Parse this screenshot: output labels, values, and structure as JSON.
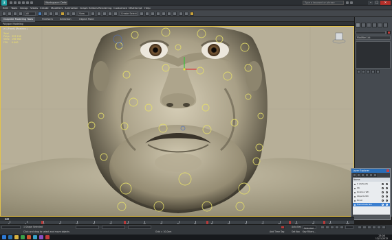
{
  "titlebar": {
    "workspace": "Workspace: Default",
    "search_placeholder": "Type a keyword or phrase"
  },
  "menus": [
    "Edit",
    "Tools",
    "Group",
    "Views",
    "Create",
    "Modifiers",
    "Animation",
    "Graph Editors",
    "Rendering",
    "Customize",
    "MAXScript",
    "Help"
  ],
  "toolbar": {
    "selection_filter": "All",
    "reference_coord": "View",
    "named_selection": "Create Selection Se"
  },
  "ribbon": {
    "tabs": [
      "Graphite Modeling Tools",
      "Freeform",
      "Selection",
      "Object Paint"
    ],
    "active_tab": "Graphite Modeling Tools",
    "sub_label": "Polygon Modeling"
  },
  "viewport": {
    "label": "[+] [Front] [Realistic]",
    "stats": [
      {
        "key": "Polys:",
        "value": "393 236"
      },
      {
        "key": "Verts:",
        "value": "196 968"
      },
      {
        "key": "FPS:",
        "value": "0.000"
      }
    ],
    "stats_header": "Total"
  },
  "command_panel": {
    "modifier_list": "Modifier List"
  },
  "layer_explorer": {
    "title": "Layer Explorer",
    "column": "Name",
    "rows": [
      {
        "label": "0 (default)",
        "selected": false
      },
      {
        "label": "Ob",
        "selected": false
      },
      {
        "label": "Drallion Wh",
        "selected": false
      },
      {
        "label": "Objects Wh",
        "selected": false
      },
      {
        "label": "Drool",
        "selected": false
      },
      {
        "label": "Hamstrate Nm",
        "selected": true
      }
    ]
  },
  "timeline": {
    "frame": "0 / 100",
    "ticks": [
      "0",
      "5",
      "10",
      "15",
      "20",
      "25",
      "30",
      "35",
      "40",
      "45",
      "50",
      "55",
      "60",
      "65",
      "70",
      "75",
      "80",
      "85",
      "90",
      "95",
      "100"
    ]
  },
  "status": {
    "selection": "1 Shape Selected",
    "prompt": "Click and drag to select and move objects",
    "auto_key": "Auto Key",
    "selected": "Selected",
    "set_key": "Set Key",
    "key_filters": "Key Filters...",
    "grid": "Grid = 10,0cm",
    "add_time_tag": "Add Time Tag"
  },
  "taskbar": {
    "time": "23:08",
    "date": "12/11/2012"
  },
  "colors": {
    "viewport_border": "#e3c24a",
    "skin": "#b3ab94",
    "selection_blue": "#3b7fd0",
    "key_red": "#b83a3a"
  }
}
